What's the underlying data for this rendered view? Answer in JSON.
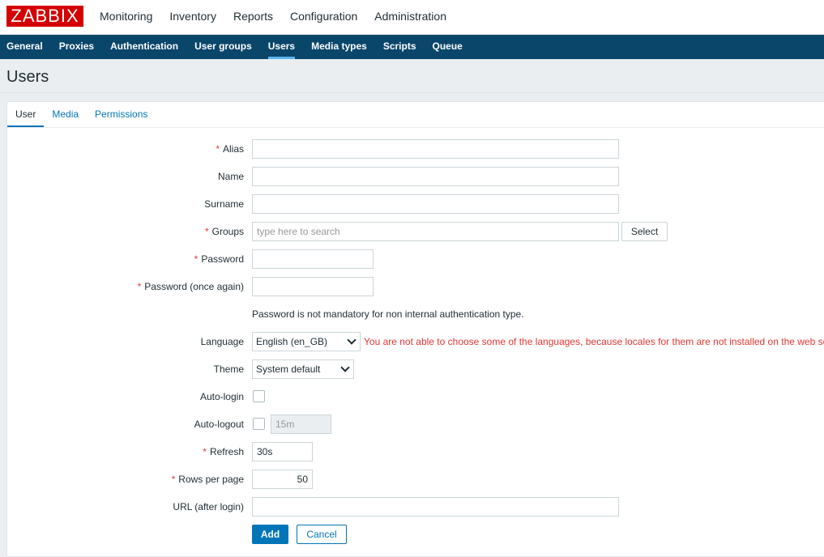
{
  "app": {
    "logo": "ZABBIX"
  },
  "top_menu": {
    "items": [
      {
        "label": "Monitoring"
      },
      {
        "label": "Inventory"
      },
      {
        "label": "Reports"
      },
      {
        "label": "Configuration"
      },
      {
        "label": "Administration"
      }
    ],
    "active": "Administration"
  },
  "sub_menu": {
    "items": [
      {
        "label": "General"
      },
      {
        "label": "Proxies"
      },
      {
        "label": "Authentication"
      },
      {
        "label": "User groups"
      },
      {
        "label": "Users"
      },
      {
        "label": "Media types"
      },
      {
        "label": "Scripts"
      },
      {
        "label": "Queue"
      }
    ],
    "active": "Users"
  },
  "page": {
    "title": "Users"
  },
  "tabs": {
    "items": [
      {
        "label": "User"
      },
      {
        "label": "Media"
      },
      {
        "label": "Permissions"
      }
    ],
    "active": "User"
  },
  "form": {
    "required_marker": "*",
    "alias": {
      "label": "Alias",
      "value": ""
    },
    "name": {
      "label": "Name",
      "value": ""
    },
    "surname": {
      "label": "Surname",
      "value": ""
    },
    "groups": {
      "label": "Groups",
      "placeholder": "type here to search",
      "select_label": "Select"
    },
    "password": {
      "label": "Password",
      "value": ""
    },
    "password_again": {
      "label": "Password (once again)",
      "value": ""
    },
    "password_hint": "Password is not mandatory for non internal authentication type.",
    "language": {
      "label": "Language",
      "value": "English (en_GB)",
      "warning": "You are not able to choose some of the languages, because locales for them are not installed on the web server."
    },
    "theme": {
      "label": "Theme",
      "value": "System default"
    },
    "autologin": {
      "label": "Auto-login",
      "checked": false
    },
    "autologout": {
      "label": "Auto-logout",
      "checked": false,
      "value": "15m"
    },
    "refresh": {
      "label": "Refresh",
      "value": "30s"
    },
    "rows_per_page": {
      "label": "Rows per page",
      "value": "50"
    },
    "url": {
      "label": "URL (after login)",
      "value": ""
    }
  },
  "actions": {
    "add_label": "Add",
    "cancel_label": "Cancel"
  },
  "colors": {
    "brand": "#d40000",
    "submenu_bg": "#0a466a",
    "accent": "#0275b8",
    "error": "#e33734"
  }
}
